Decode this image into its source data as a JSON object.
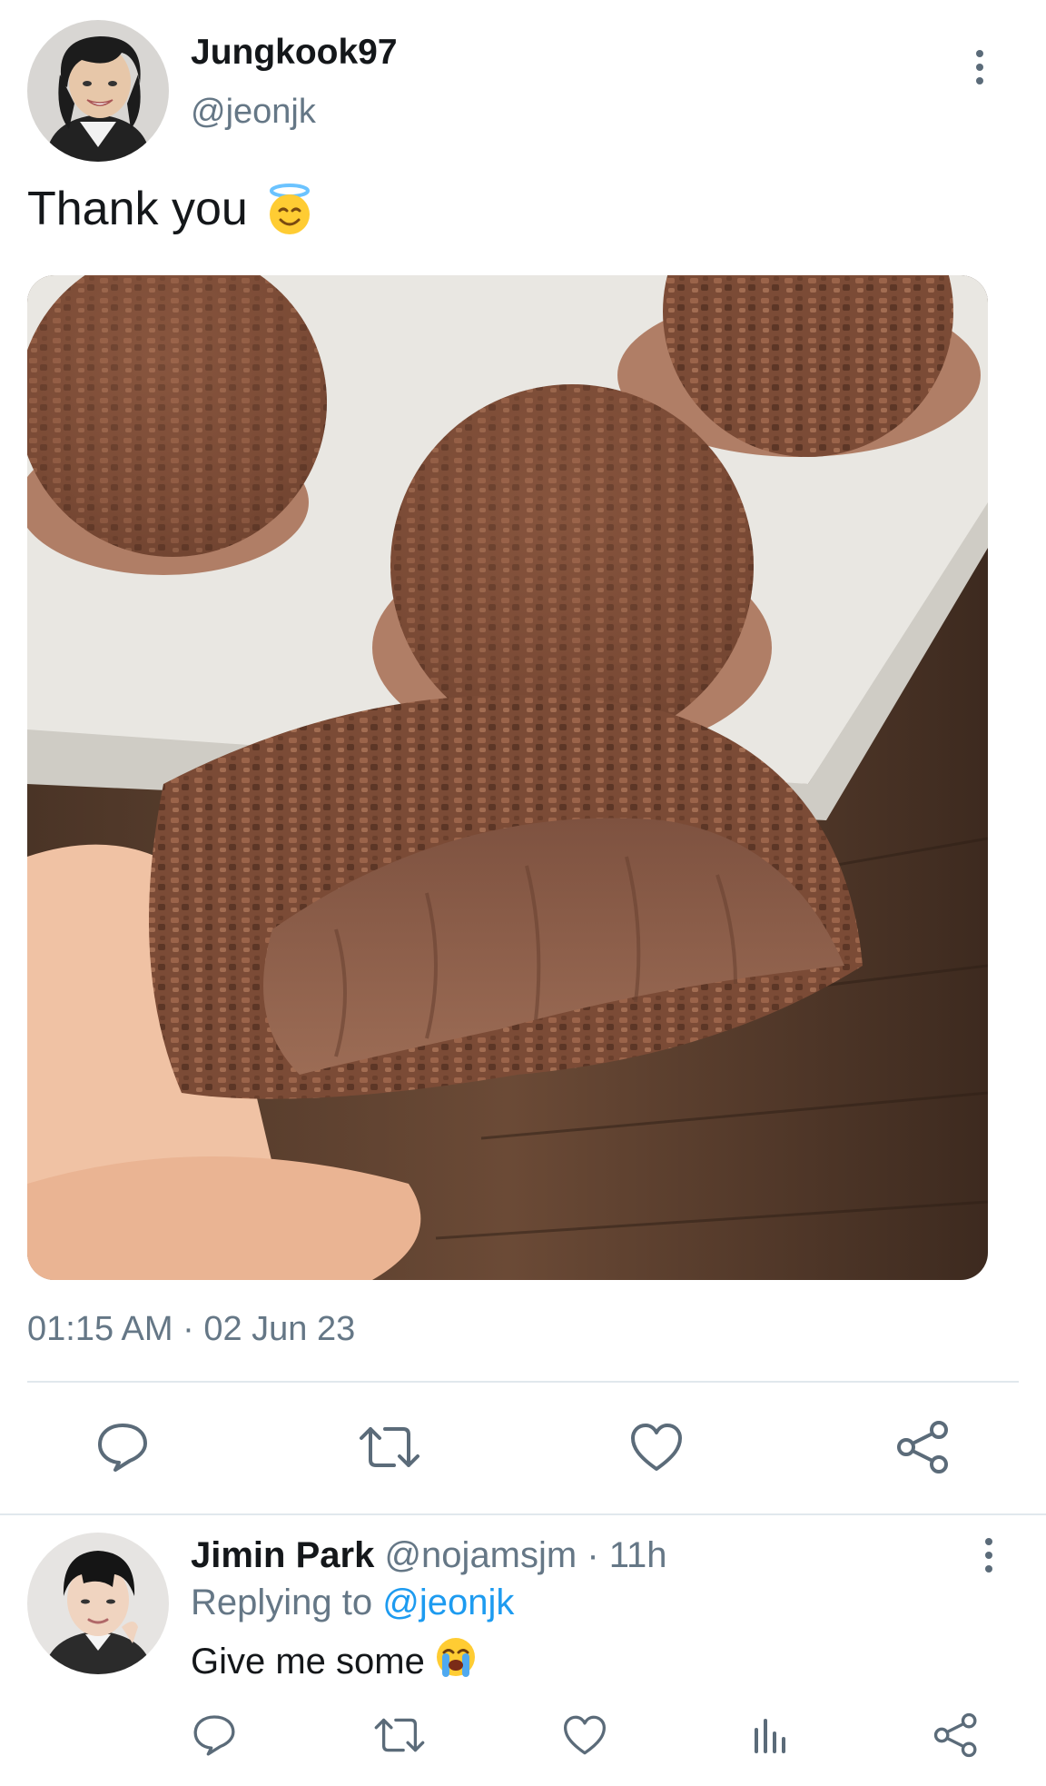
{
  "tweet": {
    "author_name": "Jungkook97",
    "author_handle": "@jeonjk",
    "text": "Thank you",
    "text_emoji": "smiling-face-with-halo",
    "media": "chocolate-brigadeiro-photo",
    "timestamp": "01:15 AM · 02 Jun 23",
    "actions": [
      "reply-icon",
      "retweet-icon",
      "like-icon",
      "share-icon"
    ]
  },
  "reply": {
    "author_name": "Jimin Park",
    "author_meta": "@nojamsjm · 11h",
    "replying_to_label": "Replying to ",
    "replying_to_handle": "@jeonjk",
    "text": "Give me some",
    "text_emoji": "loudly-crying-face",
    "actions": [
      "reply-icon",
      "retweet-icon",
      "like-icon",
      "analytics-icon",
      "share-icon"
    ]
  },
  "colors": {
    "text_primary": "#14171a",
    "text_secondary": "#657786",
    "link": "#1d9bf0",
    "divider": "#e1e8ed",
    "icon": "#5b6b79"
  }
}
